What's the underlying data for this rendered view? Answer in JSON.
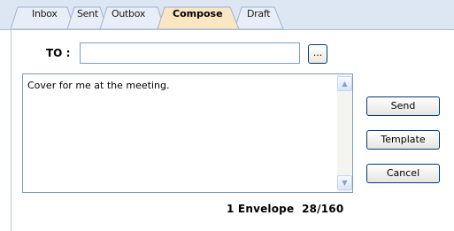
{
  "tabs": [
    {
      "label": "Inbox",
      "active": false
    },
    {
      "label": "Sent",
      "active": false
    },
    {
      "label": "Outbox",
      "active": false
    },
    {
      "label": "Compose",
      "active": true
    },
    {
      "label": "Draft",
      "active": false
    }
  ],
  "compose": {
    "to_label": "TO :",
    "to_value": "",
    "browse_label": "...",
    "message": "Cover for me at the meeting."
  },
  "buttons": {
    "send": "Send",
    "template": "Template",
    "cancel": "Cancel"
  },
  "status": {
    "text": "1 Envelope  28/160"
  },
  "colors": {
    "tab_bar": "#dde7f3",
    "active_tab": "#fbe6c4",
    "border": "#7f9db9"
  },
  "icons": {
    "scroll_up": "up-arrow-icon",
    "scroll_down": "down-arrow-icon"
  }
}
